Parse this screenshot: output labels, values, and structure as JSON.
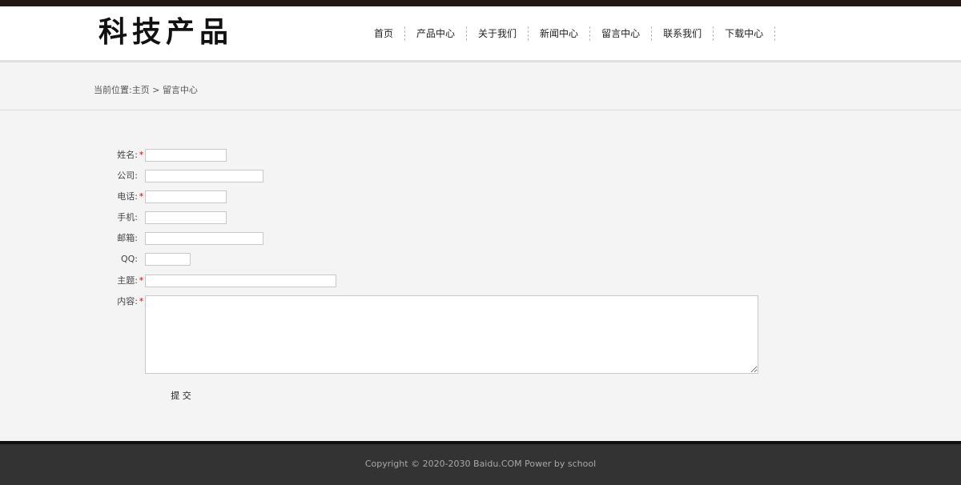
{
  "header": {
    "logo": "科技产品",
    "nav": [
      "首页",
      "产品中心",
      "关于我们",
      "新闻中心",
      "留言中心",
      "联系我们",
      "下载中心"
    ]
  },
  "breadcrumb": {
    "prefix": "当前位置:",
    "home": "主页",
    "separator": " > ",
    "current": "留言中心"
  },
  "form": {
    "name_label": "姓名:",
    "company_label": "公司:",
    "phone_label": "电话:",
    "mobile_label": "手机:",
    "email_label": "邮箱:",
    "qq_label": "QQ:",
    "subject_label": "主题:",
    "content_label": "内容:",
    "required_mark": "*",
    "submit_label": "提 交"
  },
  "footer": {
    "copyright": "Copyright © 2020-2030 Baidu.COM Power by school"
  },
  "colors": {
    "topbar": "#231815",
    "footer": "#333333",
    "required": "#dd0000"
  }
}
